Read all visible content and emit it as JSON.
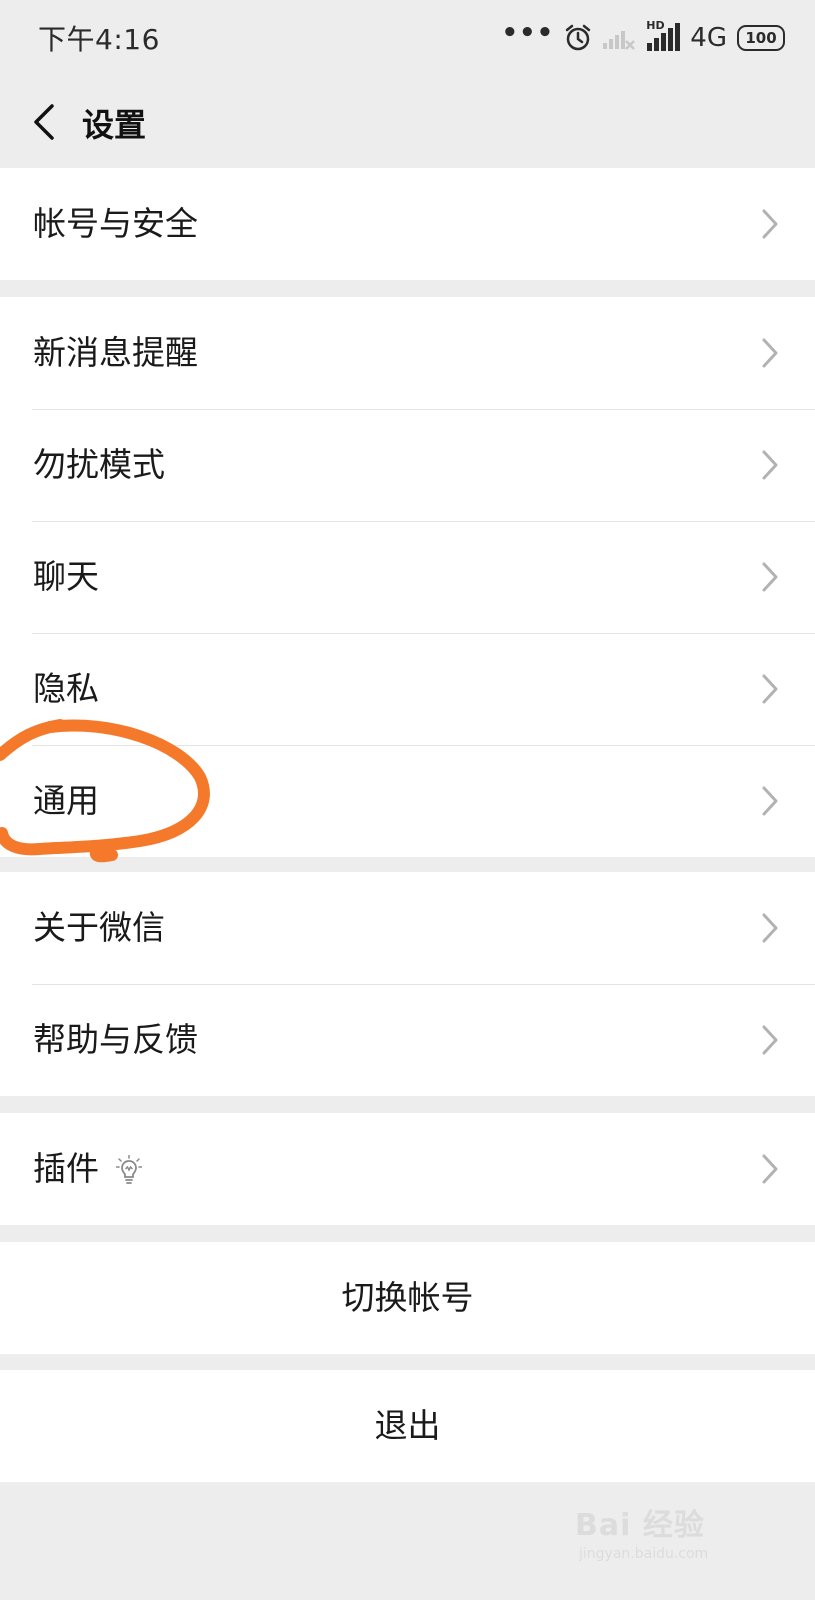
{
  "status_bar": {
    "time": "下午4:16",
    "dots": "•••",
    "network": "4G",
    "hd": "HD",
    "battery": "100"
  },
  "nav": {
    "title": "设置",
    "back_icon": "chevron-left-icon"
  },
  "groups": {
    "account": [
      "帐号与安全"
    ],
    "main": [
      "新消息提醒",
      "勿扰模式",
      "聊天",
      "隐私",
      "通用"
    ],
    "about": [
      "关于微信",
      "帮助与反馈"
    ],
    "plugins": [
      "插件"
    ]
  },
  "actions": {
    "switch_account": "切换帐号",
    "logout": "退出"
  },
  "annotation": {
    "color": "#f5792a",
    "target": "通用"
  },
  "watermark": {
    "brand": "Bai 经验",
    "sub": "jingyan.baidu.com"
  },
  "colors": {
    "background": "#ededed",
    "row": "#ffffff",
    "separator": "#e3e3e3",
    "chevron": "#b2b2b2"
  }
}
